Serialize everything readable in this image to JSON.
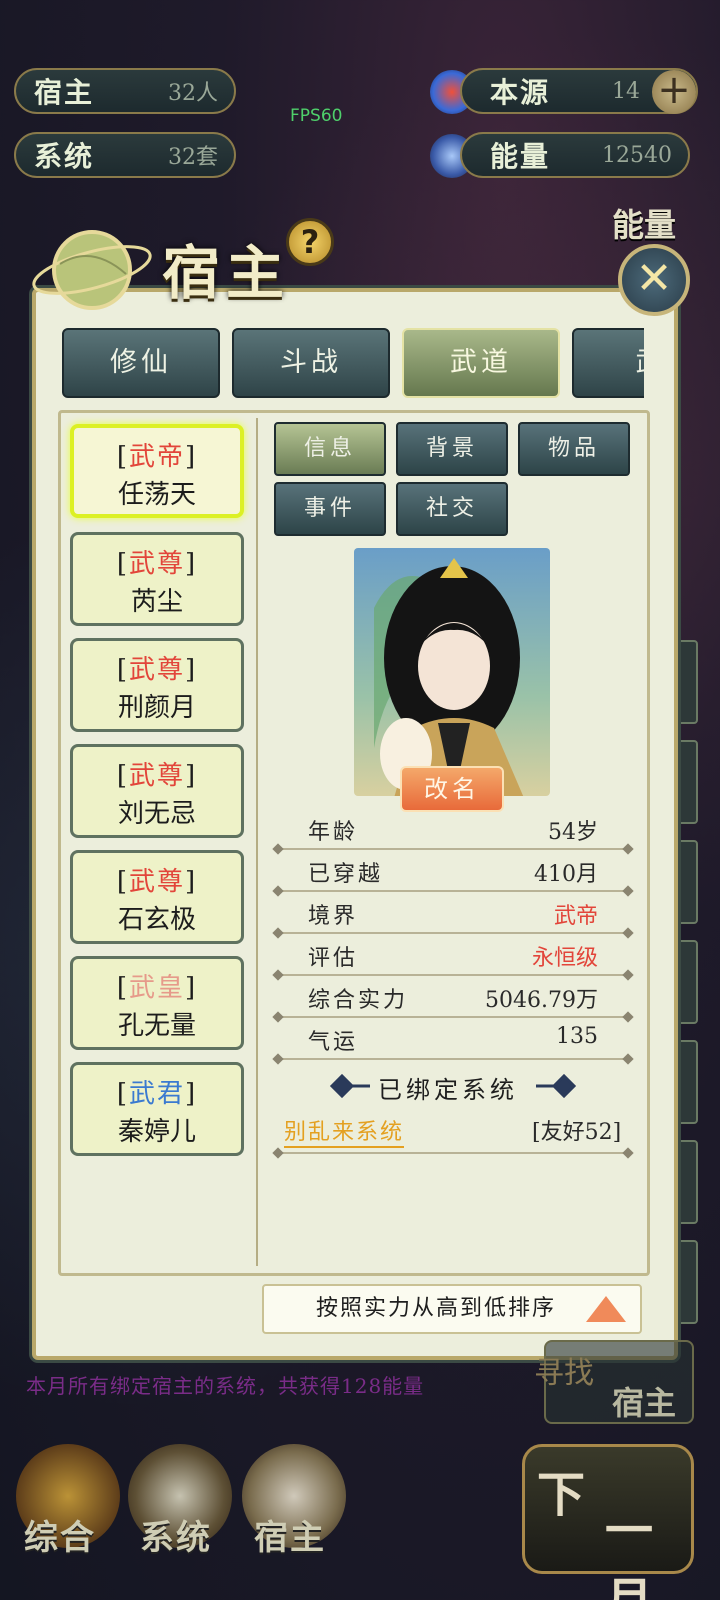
{
  "top_resources": {
    "host": {
      "label": "宿主",
      "value": "32人"
    },
    "system": {
      "label": "系统",
      "value": "32套"
    },
    "source": {
      "label": "本源",
      "value": "14"
    },
    "energy": {
      "label": "能量",
      "value": "12540"
    }
  },
  "fps": "FPS60",
  "side_label": "能量",
  "panel": {
    "title": "宿主",
    "help": "?",
    "tabs": [
      "修仙",
      "斗战",
      "武道",
      "武"
    ],
    "active_tab": 2,
    "hosts": [
      {
        "rank": "武帝",
        "name": "任荡天",
        "rank_color": "#e2453a"
      },
      {
        "rank": "武尊",
        "name": "芮尘",
        "rank_color": "#e2453a"
      },
      {
        "rank": "武尊",
        "name": "刑颜月",
        "rank_color": "#e2453a"
      },
      {
        "rank": "武尊",
        "name": "刘无忌",
        "rank_color": "#e2453a"
      },
      {
        "rank": "武尊",
        "name": "石玄极",
        "rank_color": "#e2453a"
      },
      {
        "rank": "武皇",
        "name": "孔无量",
        "rank_color": "#e69a8a"
      },
      {
        "rank": "武君",
        "name": "秦婷儿",
        "rank_color": "#3a7ad0"
      }
    ],
    "subtabs": [
      "信息",
      "背景",
      "物品",
      "事件",
      "社交"
    ],
    "active_subtab": 0,
    "rename": "改名",
    "info": [
      {
        "key": "年龄",
        "value": "54岁"
      },
      {
        "key": "已穿越",
        "value": "410月"
      },
      {
        "key": "境界",
        "value": "武帝"
      },
      {
        "key": "评估",
        "value": "永恒级"
      },
      {
        "key": "综合实力",
        "value": "5046.79万"
      },
      {
        "key": "气运",
        "value": "135"
      }
    ],
    "bound_title": "已绑定系统",
    "bound_system": {
      "name": "别乱来系统",
      "friendship": "[友好52]"
    },
    "sort_label": "按照实力从高到低排序"
  },
  "bottom": {
    "message": "本月所有绑定宿主的系统，共获得128能量",
    "find_host": {
      "line1": "寻找",
      "line2": "宿主"
    },
    "nav": [
      "综合",
      "系统",
      "宿主"
    ],
    "next_month": {
      "line1": "下",
      "line2": "一月"
    }
  }
}
